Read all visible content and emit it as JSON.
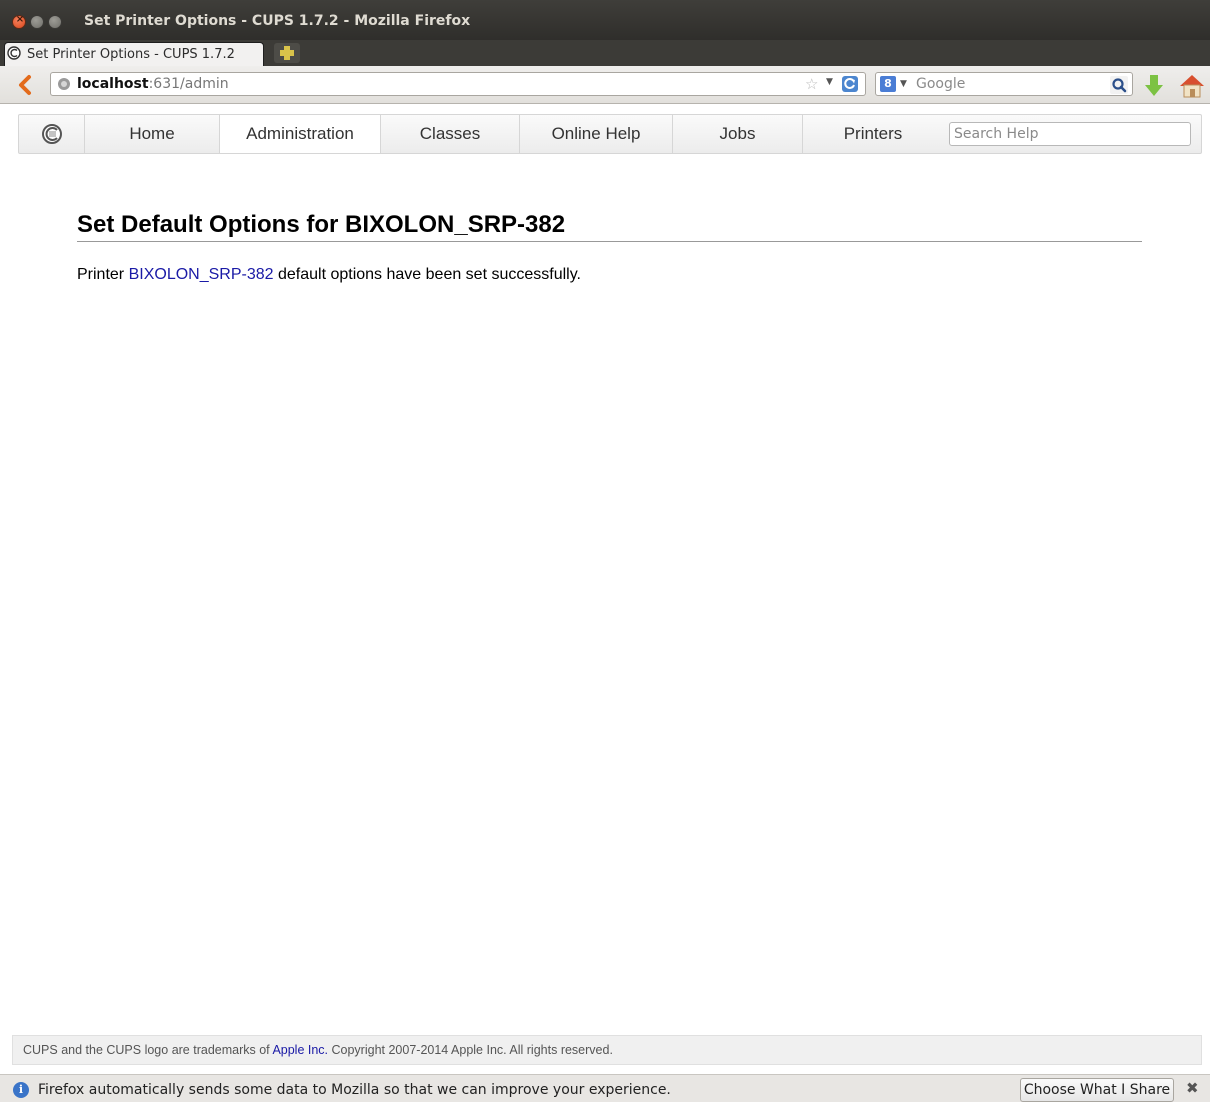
{
  "window": {
    "title": "Set Printer Options - CUPS 1.7.2 - Mozilla Firefox"
  },
  "tab": {
    "label": "Set Printer Options - CUPS 1.7.2",
    "favicon": "cups-logo-icon"
  },
  "address_bar": {
    "host": "localhost",
    "path": ":631/admin"
  },
  "search_bar": {
    "engine": "Google",
    "placeholder": "Google"
  },
  "cups_nav": {
    "items": [
      {
        "label": "Home",
        "active": false
      },
      {
        "label": "Administration",
        "active": true
      },
      {
        "label": "Classes",
        "active": false
      },
      {
        "label": "Online Help",
        "active": false
      },
      {
        "label": "Jobs",
        "active": false
      },
      {
        "label": "Printers",
        "active": false
      }
    ],
    "search_placeholder": "Search Help"
  },
  "main": {
    "heading": "Set Default Options for BIXOLON_SRP-382",
    "message_prefix": "Printer ",
    "printer_link": "BIXOLON_SRP-382",
    "message_suffix": " default options have been set successfully."
  },
  "footer": {
    "text_prefix": "CUPS and the CUPS logo are trademarks of ",
    "apple_link": "Apple Inc.",
    "text_suffix": " Copyright 2007-2014 Apple Inc. All rights reserved."
  },
  "notification": {
    "text": "Firefox automatically sends some data to Mozilla so that we can improve your experience.",
    "button_label": "Choose What I Share",
    "close_glyph": "✖"
  },
  "colors": {
    "link": "#1a1aa6",
    "titlebar": "#3c3b37",
    "close_button": "#e2562a"
  }
}
